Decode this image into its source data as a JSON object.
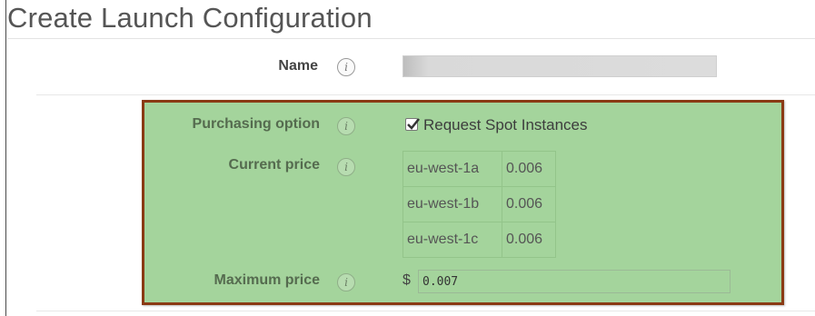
{
  "page": {
    "title": "Create Launch Configuration"
  },
  "form": {
    "name": {
      "label": "Name",
      "value": ""
    },
    "purchasing_option": {
      "label": "Purchasing option",
      "checkbox_label": "Request Spot Instances",
      "checked": true
    },
    "current_price": {
      "label": "Current price",
      "rows": [
        {
          "zone": "eu-west-1a",
          "price": "0.006"
        },
        {
          "zone": "eu-west-1b",
          "price": "0.006"
        },
        {
          "zone": "eu-west-1c",
          "price": "0.006"
        }
      ]
    },
    "maximum_price": {
      "label": "Maximum price",
      "currency": "$",
      "value": "0.007"
    }
  },
  "icons": {
    "info": "info-icon",
    "info_glyph": "i"
  },
  "colors": {
    "highlight_panel": "#a4d49c",
    "highlight_border": "#8a3a14"
  }
}
